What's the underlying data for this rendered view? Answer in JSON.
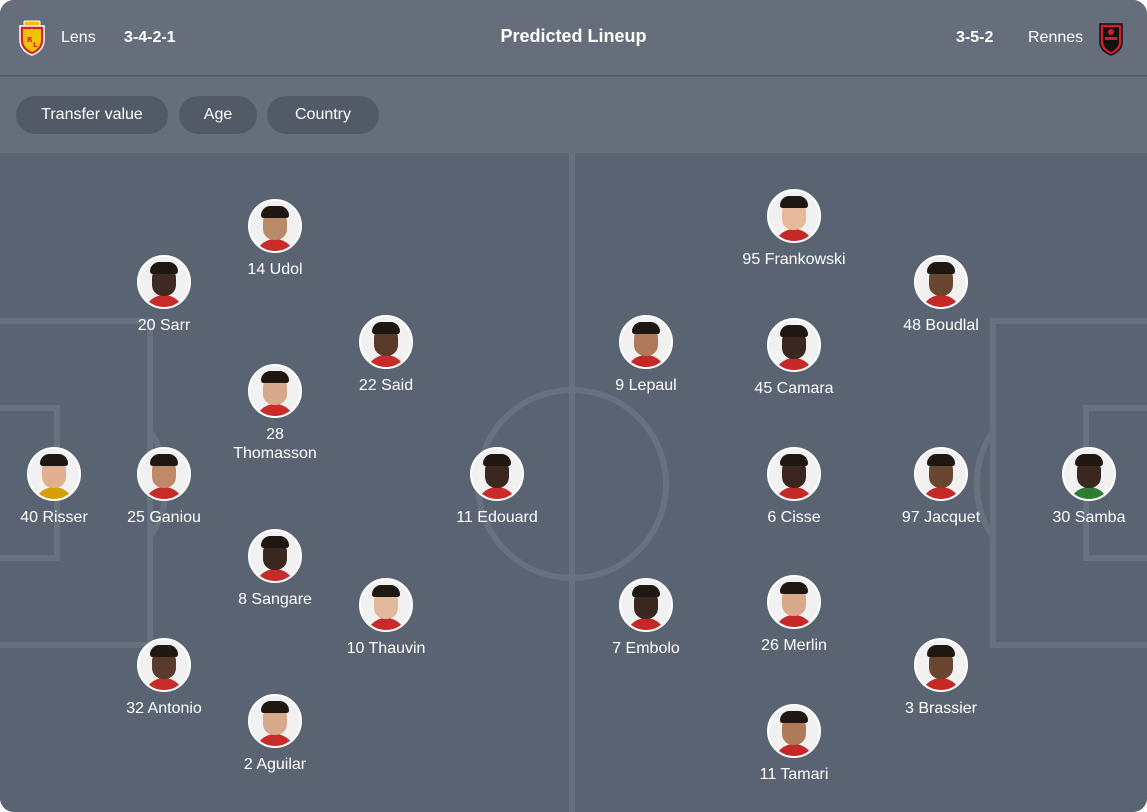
{
  "header": {
    "title": "Predicted Lineup",
    "home": {
      "name": "Lens",
      "formation": "3-4-2-1",
      "logo_icon": "lens-crest-icon",
      "color": "#f2c300"
    },
    "away": {
      "name": "Rennes",
      "formation": "3-5-2",
      "logo_icon": "rennes-crest-icon",
      "color": "#d41e2b"
    }
  },
  "filters": [
    {
      "label": "Transfer value"
    },
    {
      "label": "Age"
    },
    {
      "label": "Country"
    }
  ],
  "colors": {
    "pitch": "#5a6371",
    "header": "#656e7a",
    "chip": "#515a66",
    "line": "#6b7482"
  },
  "home_players": [
    {
      "label": "14 Udol",
      "skin": "#b98a6a",
      "kit": "#c92a2a"
    },
    {
      "label": "20 Sarr",
      "skin": "#3d2a22",
      "kit": "#c92a2a"
    },
    {
      "label": "22 Said",
      "skin": "#5a3a2a",
      "kit": "#c92a2a"
    },
    {
      "label": "28\nThomasson",
      "skin": "#d8a88a",
      "kit": "#c92a2a"
    },
    {
      "label": "40 Risser",
      "skin": "#e0b090",
      "kit": "#d6a100"
    },
    {
      "label": "25 Ganiou",
      "skin": "#c08a6a",
      "kit": "#c92a2a"
    },
    {
      "label": "11 Edouard",
      "skin": "#3a2820",
      "kit": "#c92a2a"
    },
    {
      "label": "8 Sangare",
      "skin": "#3a2820",
      "kit": "#c92a2a"
    },
    {
      "label": "10 Thauvin",
      "skin": "#e2b89a",
      "kit": "#c92a2a"
    },
    {
      "label": "32 Antonio",
      "skin": "#5a3a2a",
      "kit": "#c92a2a"
    },
    {
      "label": "2 Aguilar",
      "skin": "#d8a88a",
      "kit": "#c92a2a"
    }
  ],
  "away_players": [
    {
      "label": "95 Frankowski",
      "skin": "#e8b89a",
      "kit": "#c62828"
    },
    {
      "label": "48 Boudlal",
      "skin": "#6a4530",
      "kit": "#c62828"
    },
    {
      "label": "9 Lepaul",
      "skin": "#b07a5a",
      "kit": "#c62828"
    },
    {
      "label": "45 Camara",
      "skin": "#3a2820",
      "kit": "#c62828"
    },
    {
      "label": "6 Cisse",
      "skin": "#3a2820",
      "kit": "#c62828"
    },
    {
      "label": "97 Jacquet",
      "skin": "#6a4530",
      "kit": "#c62828"
    },
    {
      "label": "30 Samba",
      "skin": "#3a2820",
      "kit": "#2e7d32"
    },
    {
      "label": "7 Embolo",
      "skin": "#3a2820",
      "kit": "#c62828"
    },
    {
      "label": "26 Merlin",
      "skin": "#d8a88a",
      "kit": "#c62828"
    },
    {
      "label": "3 Brassier",
      "skin": "#6a4530",
      "kit": "#c62828"
    },
    {
      "label": "11 Tamari",
      "skin": "#b07a5a",
      "kit": "#c62828"
    }
  ]
}
